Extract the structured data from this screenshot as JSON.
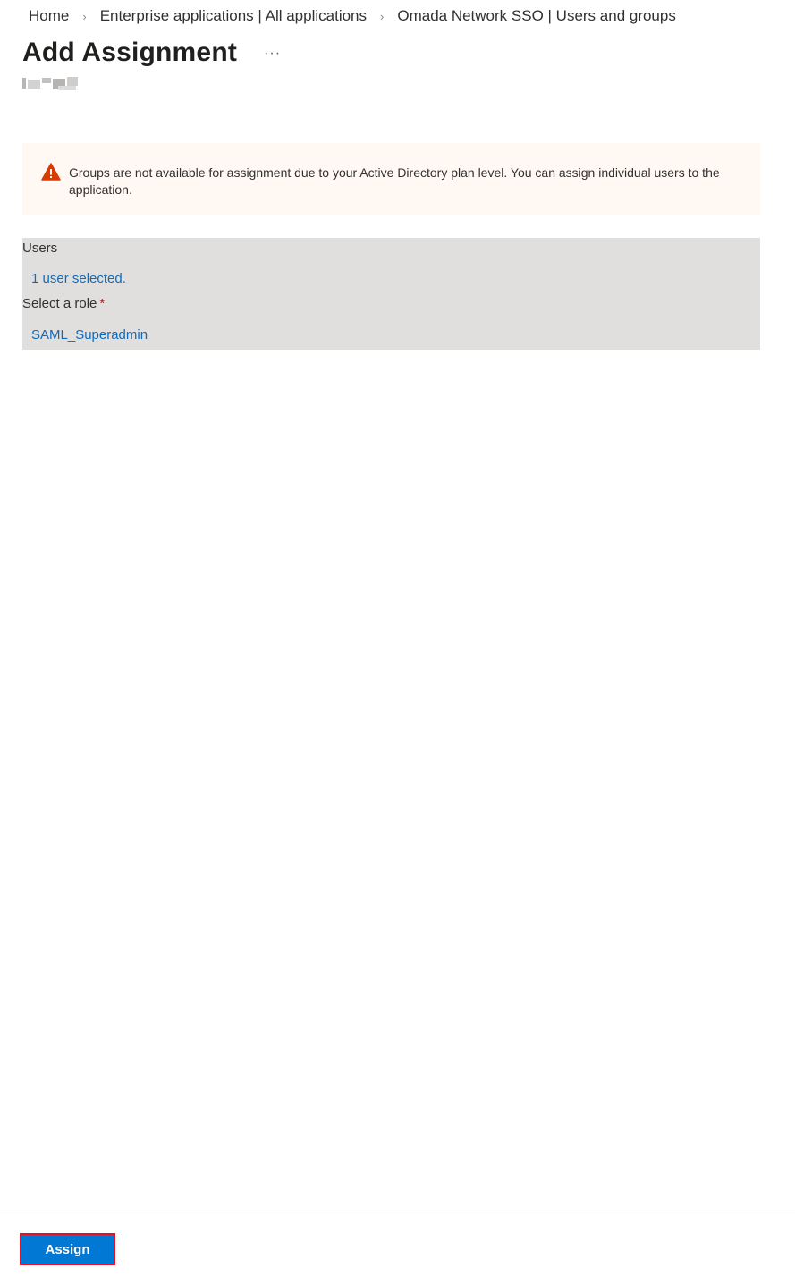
{
  "breadcrumb": {
    "items": [
      {
        "label": "Home"
      },
      {
        "label": "Enterprise applications | All applications"
      },
      {
        "label": "Omada Network SSO | Users and groups"
      }
    ],
    "separator_icon": "chevron-right-icon"
  },
  "header": {
    "title": "Add Assignment",
    "more_label": "···"
  },
  "warning": {
    "icon": "warning-icon",
    "color": "#d83b01",
    "text": "Groups are not available for assignment due to your Active Directory plan level. You can assign individual users to the application."
  },
  "form": {
    "users_label": "Users",
    "users_value": "1 user selected.",
    "role_label": "Select a role",
    "role_required_marker": "*",
    "role_value": "SAML_Superadmin"
  },
  "footer": {
    "assign_label": "Assign"
  },
  "colors": {
    "accent": "#0078d4",
    "link": "#0f6cbd",
    "highlight_border": "#e81123",
    "panel_bg": "#e1dfdd",
    "warning_bg": "#fff8f3"
  }
}
